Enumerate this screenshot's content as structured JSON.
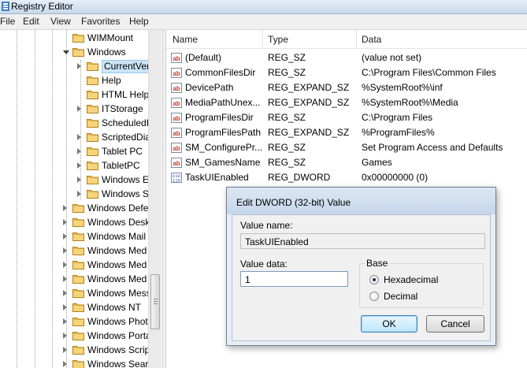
{
  "window": {
    "title": "Registry Editor",
    "icon": "registry-icon"
  },
  "menu": [
    "File",
    "Edit",
    "View",
    "Favorites",
    "Help"
  ],
  "tree": {
    "items": [
      {
        "label": "WIMMount",
        "selected": false,
        "expanded": false,
        "has_children": false
      },
      {
        "label": "Windows",
        "selected": false,
        "expanded": true,
        "has_children": true
      },
      {
        "label": "CurrentVer",
        "selected": true,
        "expanded": false,
        "has_children": true
      },
      {
        "label": "Help",
        "selected": false,
        "expanded": false,
        "has_children": false
      },
      {
        "label": "HTML Help",
        "selected": false,
        "expanded": false,
        "has_children": false
      },
      {
        "label": "ITStorage",
        "selected": false,
        "expanded": false,
        "has_children": true
      },
      {
        "label": "ScheduledI",
        "selected": false,
        "expanded": false,
        "has_children": false
      },
      {
        "label": "ScriptedDia",
        "selected": false,
        "expanded": false,
        "has_children": true
      },
      {
        "label": "Tablet PC",
        "selected": false,
        "expanded": false,
        "has_children": true
      },
      {
        "label": "TabletPC",
        "selected": false,
        "expanded": false,
        "has_children": true
      },
      {
        "label": "Windows E",
        "selected": false,
        "expanded": false,
        "has_children": true
      },
      {
        "label": "Windows S",
        "selected": false,
        "expanded": false,
        "has_children": true
      },
      {
        "label": "Windows Defe",
        "selected": false,
        "expanded": false,
        "has_children": true
      },
      {
        "label": "Windows Desk",
        "selected": false,
        "expanded": false,
        "has_children": true
      },
      {
        "label": "Windows Mail",
        "selected": false,
        "expanded": false,
        "has_children": true
      },
      {
        "label": "Windows Med",
        "selected": false,
        "expanded": false,
        "has_children": true
      },
      {
        "label": "Windows Med",
        "selected": false,
        "expanded": false,
        "has_children": true
      },
      {
        "label": "Windows Med",
        "selected": false,
        "expanded": false,
        "has_children": true
      },
      {
        "label": "Windows Mess",
        "selected": false,
        "expanded": false,
        "has_children": true
      },
      {
        "label": "Windows NT",
        "selected": false,
        "expanded": false,
        "has_children": true
      },
      {
        "label": "Windows Phot",
        "selected": false,
        "expanded": false,
        "has_children": true
      },
      {
        "label": "Windows Porta",
        "selected": false,
        "expanded": false,
        "has_children": true
      },
      {
        "label": "Windows Scrip",
        "selected": false,
        "expanded": false,
        "has_children": true
      },
      {
        "label": "Windows Sear",
        "selected": false,
        "expanded": false,
        "has_children": true
      }
    ]
  },
  "list": {
    "columns": [
      "Name",
      "Type",
      "Data"
    ],
    "rows": [
      {
        "icon": "string-value-icon",
        "name": "(Default)",
        "type": "REG_SZ",
        "data": "(value not set)"
      },
      {
        "icon": "string-value-icon",
        "name": "CommonFilesDir",
        "type": "REG_SZ",
        "data": "C:\\Program Files\\Common Files"
      },
      {
        "icon": "string-value-icon",
        "name": "DevicePath",
        "type": "REG_EXPAND_SZ",
        "data": "%SystemRoot%\\inf"
      },
      {
        "icon": "string-value-icon",
        "name": "MediaPathUnex...",
        "type": "REG_EXPAND_SZ",
        "data": "%SystemRoot%\\Media"
      },
      {
        "icon": "string-value-icon",
        "name": "ProgramFilesDir",
        "type": "REG_SZ",
        "data": "C:\\Program Files"
      },
      {
        "icon": "string-value-icon",
        "name": "ProgramFilesPath",
        "type": "REG_EXPAND_SZ",
        "data": "%ProgramFiles%"
      },
      {
        "icon": "string-value-icon",
        "name": "SM_ConfigurePr...",
        "type": "REG_SZ",
        "data": "Set Program Access and Defaults"
      },
      {
        "icon": "string-value-icon",
        "name": "SM_GamesName",
        "type": "REG_SZ",
        "data": "Games"
      },
      {
        "icon": "binary-value-icon",
        "name": "TaskUIEnabled",
        "type": "REG_DWORD",
        "data": "0x00000000 (0)"
      }
    ]
  },
  "dialog": {
    "title": "Edit DWORD (32-bit) Value",
    "value_name_label": "Value name:",
    "value_name": "TaskUIEnabled",
    "value_data_label": "Value data:",
    "value_data": "1",
    "base_label": "Base",
    "radio_hex": "Hexadecimal",
    "radio_dec": "Decimal",
    "selected_base": "Hexadecimal",
    "ok_label": "OK",
    "cancel_label": "Cancel"
  },
  "colors": {
    "folder": "#e8b84a",
    "selection": "#cce4f7",
    "string_icon": "#c0392b",
    "binary_icon": "#2e5fa8"
  }
}
